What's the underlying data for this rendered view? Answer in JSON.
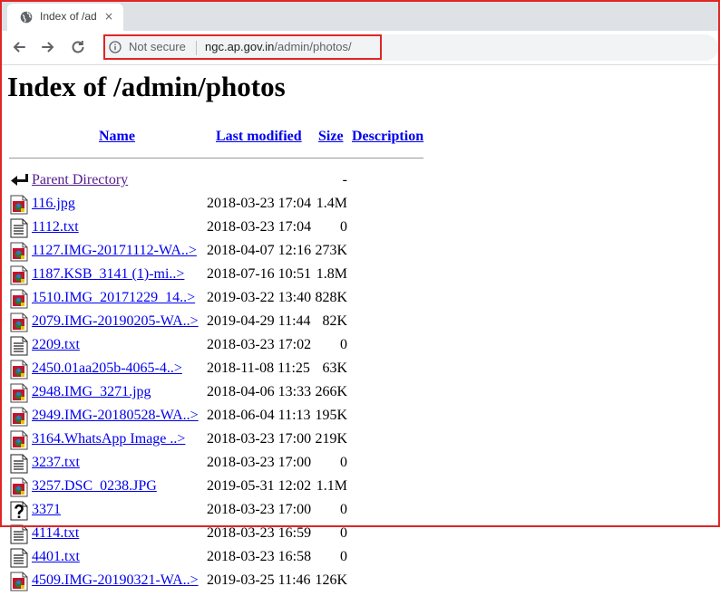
{
  "browser": {
    "tab_title": "Index of /ad",
    "close_glyph": "×",
    "security_label": "Not secure",
    "url_host": "ngc.ap.gov.in",
    "url_path": "/admin/photos/"
  },
  "page": {
    "title": "Index of /admin/photos",
    "columns": {
      "name": "Name",
      "last_modified": "Last modified",
      "size": "Size",
      "description": "Description"
    }
  },
  "entries": [
    {
      "name": "Parent Directory",
      "date": "",
      "size": "-",
      "icon": "back-icon"
    },
    {
      "name": "116.jpg",
      "date": "2018-03-23 17:04",
      "size": "1.4M",
      "icon": "image-icon"
    },
    {
      "name": "1112.txt",
      "date": "2018-03-23 17:04",
      "size": "0",
      "icon": "text-icon"
    },
    {
      "name": "1127.IMG-20171112-WA..>",
      "date": "2018-04-07 12:16",
      "size": "273K",
      "icon": "image-icon"
    },
    {
      "name": "1187.KSB_3141 (1)-mi..>",
      "date": "2018-07-16 10:51",
      "size": "1.8M",
      "icon": "image-icon"
    },
    {
      "name": "1510.IMG_20171229_14..>",
      "date": "2019-03-22 13:40",
      "size": "828K",
      "icon": "image-icon"
    },
    {
      "name": "2079.IMG-20190205-WA..>",
      "date": "2019-04-29 11:44",
      "size": "82K",
      "icon": "image-icon"
    },
    {
      "name": "2209.txt",
      "date": "2018-03-23 17:02",
      "size": "0",
      "icon": "text-icon"
    },
    {
      "name": "2450.01aa205b-4065-4..>",
      "date": "2018-11-08 11:25",
      "size": "63K",
      "icon": "image-icon"
    },
    {
      "name": "2948.IMG_3271.jpg",
      "date": "2018-04-06 13:33",
      "size": "266K",
      "icon": "image-icon"
    },
    {
      "name": "2949.IMG-20180528-WA..>",
      "date": "2018-06-04 11:13",
      "size": "195K",
      "icon": "image-icon"
    },
    {
      "name": "3164.WhatsApp Image ..>",
      "date": "2018-03-23 17:00",
      "size": "219K",
      "icon": "image-icon"
    },
    {
      "name": "3237.txt",
      "date": "2018-03-23 17:00",
      "size": "0",
      "icon": "text-icon"
    },
    {
      "name": "3257.DSC_0238.JPG",
      "date": "2019-05-31 12:02",
      "size": "1.1M",
      "icon": "image-icon"
    },
    {
      "name": "3371",
      "date": "2018-03-23 17:00",
      "size": "0",
      "icon": "unknown-icon"
    },
    {
      "name": "4114.txt",
      "date": "2018-03-23 16:59",
      "size": "0",
      "icon": "text-icon"
    },
    {
      "name": "4401.txt",
      "date": "2018-03-23 16:58",
      "size": "0",
      "icon": "text-icon"
    },
    {
      "name": "4509.IMG-20190321-WA..>",
      "date": "2019-03-25 11:46",
      "size": "126K",
      "icon": "image-icon"
    }
  ],
  "colors": {
    "link": "#0000ee",
    "visited": "#551a8b",
    "highlight": "#e02525"
  }
}
